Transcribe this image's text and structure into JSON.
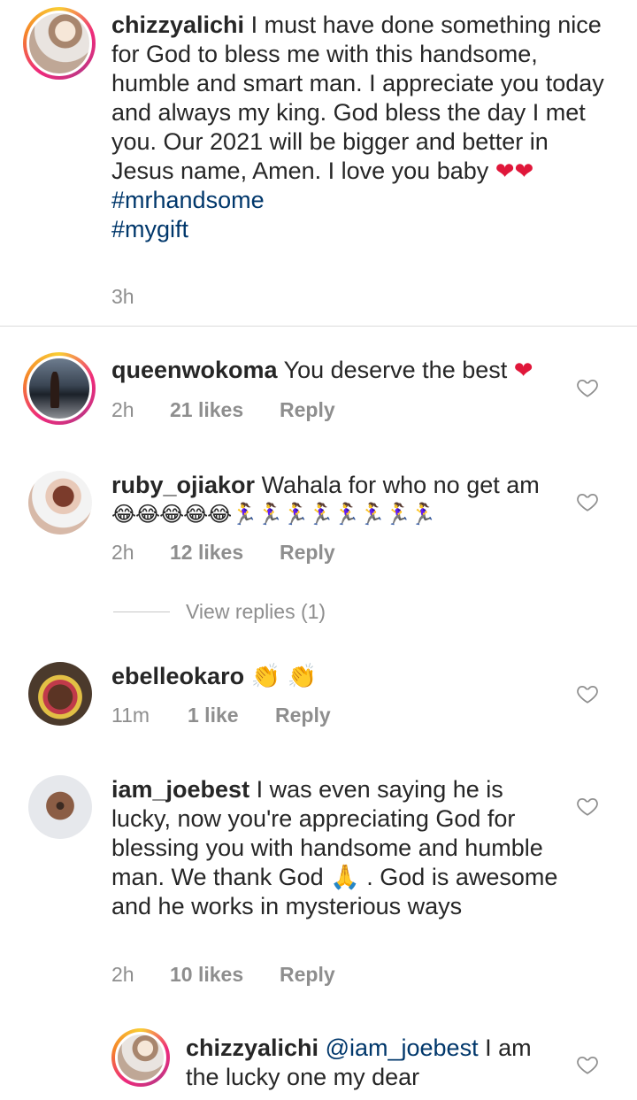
{
  "caption": {
    "username": "chizzyalichi",
    "text": "I must have done something nice for God to bless me with this handsome, humble and smart man. I appreciate you today and always my king. God bless the day I met you. Our 2021 will be bigger and better in Jesus name, Amen. I love you baby",
    "emoji": "❤❤",
    "hashtags": [
      "#mrhandsome",
      "#mygift"
    ],
    "time": "3h"
  },
  "comments": [
    {
      "username": "queenwokoma",
      "text": "You deserve the best",
      "emoji": "❤",
      "time": "2h",
      "likes": "21 likes",
      "reply": "Reply"
    },
    {
      "username": "ruby_ojiakor",
      "text": "Wahala for who no get am",
      "emoji": "😂😂😂😂😂🏃‍♀️🏃‍♀️🏃‍♀️🏃‍♀️🏃‍♀️🏃‍♀️🏃‍♀️🏃‍♀️",
      "time": "2h",
      "likes": "12 likes",
      "reply": "Reply",
      "view_replies": "View replies (1)"
    },
    {
      "username": "ebelleokaro",
      "text": "",
      "emoji": "👏 👏",
      "time": "11m",
      "likes": "1 like",
      "reply": "Reply"
    },
    {
      "username": "iam_joebest",
      "text": "I was even saying he is lucky, now you're appreciating God for blessing you with handsome and humble man. We thank God",
      "emoji": "🙏",
      "text_after": ". God is awesome and he works in mysterious ways",
      "time": "2h",
      "likes": "10 likes",
      "reply": "Reply"
    }
  ],
  "reply": {
    "username": "chizzyalichi",
    "mention": "@iam_joebest",
    "text": "I am the lucky one my dear"
  },
  "colors": {
    "link": "#00376b",
    "meta": "#8e8e8e",
    "heart": "#e0173a"
  },
  "icons": [
    "heart-outline-icon"
  ]
}
